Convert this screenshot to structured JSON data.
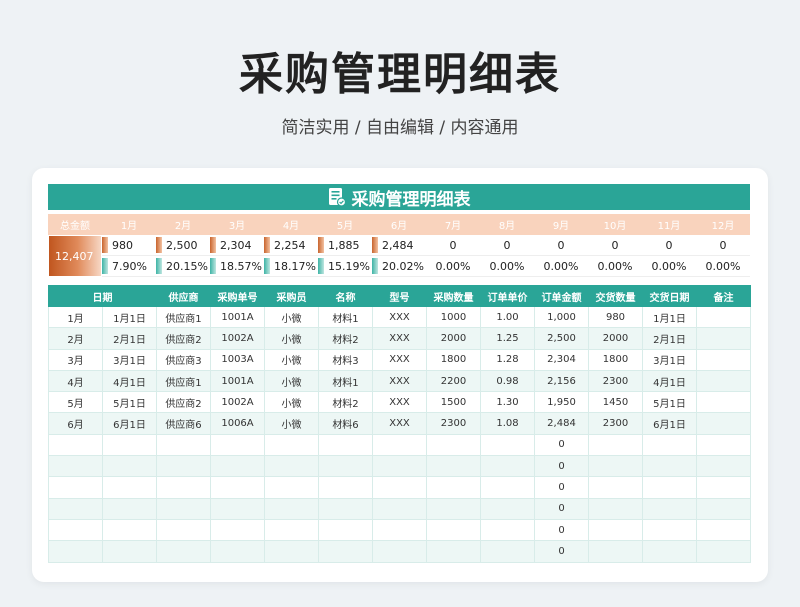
{
  "page": {
    "title": "采购管理明细表",
    "subtitle": "简洁实用 / 自由编辑 / 内容通用"
  },
  "sheet": {
    "title": "采购管理明细表",
    "icon": "document-icon"
  },
  "summary": {
    "headers": [
      "总金额",
      "1月",
      "2月",
      "3月",
      "4月",
      "5月",
      "6月",
      "7月",
      "8月",
      "9月",
      "10月",
      "11月",
      "12月"
    ],
    "total": "12,407",
    "amounts": [
      "980",
      "2,500",
      "2,304",
      "2,254",
      "1,885",
      "2,484",
      "0",
      "0",
      "0",
      "0",
      "0",
      "0"
    ],
    "percents": [
      "7.90%",
      "20.15%",
      "18.57%",
      "18.17%",
      "15.19%",
      "20.02%",
      "0.00%",
      "0.00%",
      "0.00%",
      "0.00%",
      "0.00%",
      "0.00%"
    ]
  },
  "table": {
    "headers": [
      "日期",
      "供应商",
      "采购单号",
      "采购员",
      "名称",
      "型号",
      "采购数量",
      "订单单价",
      "订单金额",
      "交货数量",
      "交货日期",
      "备注"
    ],
    "rows": [
      [
        "1月",
        "1月1日",
        "供应商1",
        "1001A",
        "小微",
        "材料1",
        "XXX",
        "1000",
        "1.00",
        "1,000",
        "980",
        "1月1日",
        ""
      ],
      [
        "2月",
        "2月1日",
        "供应商2",
        "1002A",
        "小微",
        "材料2",
        "XXX",
        "2000",
        "1.25",
        "2,500",
        "2000",
        "2月1日",
        ""
      ],
      [
        "3月",
        "3月1日",
        "供应商3",
        "1003A",
        "小微",
        "材料3",
        "XXX",
        "1800",
        "1.28",
        "2,304",
        "1800",
        "3月1日",
        ""
      ],
      [
        "4月",
        "4月1日",
        "供应商1",
        "1001A",
        "小微",
        "材料1",
        "XXX",
        "2200",
        "0.98",
        "2,156",
        "2300",
        "4月1日",
        ""
      ],
      [
        "5月",
        "5月1日",
        "供应商2",
        "1002A",
        "小微",
        "材料2",
        "XXX",
        "1500",
        "1.30",
        "1,950",
        "1450",
        "5月1日",
        ""
      ],
      [
        "6月",
        "6月1日",
        "供应商6",
        "1006A",
        "小微",
        "材料6",
        "XXX",
        "2300",
        "1.08",
        "2,484",
        "2300",
        "6月1日",
        ""
      ],
      [
        "",
        "",
        "",
        "",
        "",
        "",
        "",
        "",
        "",
        "0",
        "",
        "",
        ""
      ],
      [
        "",
        "",
        "",
        "",
        "",
        "",
        "",
        "",
        "",
        "0",
        "",
        "",
        ""
      ],
      [
        "",
        "",
        "",
        "",
        "",
        "",
        "",
        "",
        "",
        "0",
        "",
        "",
        ""
      ],
      [
        "",
        "",
        "",
        "",
        "",
        "",
        "",
        "",
        "",
        "0",
        "",
        "",
        ""
      ],
      [
        "",
        "",
        "",
        "",
        "",
        "",
        "",
        "",
        "",
        "0",
        "",
        "",
        ""
      ],
      [
        "",
        "",
        "",
        "",
        "",
        "",
        "",
        "",
        "",
        "0",
        "",
        "",
        ""
      ]
    ]
  },
  "colors": {
    "teal": "#2aa597",
    "peach": "#f9d3bd",
    "orange": "#c9652e"
  }
}
